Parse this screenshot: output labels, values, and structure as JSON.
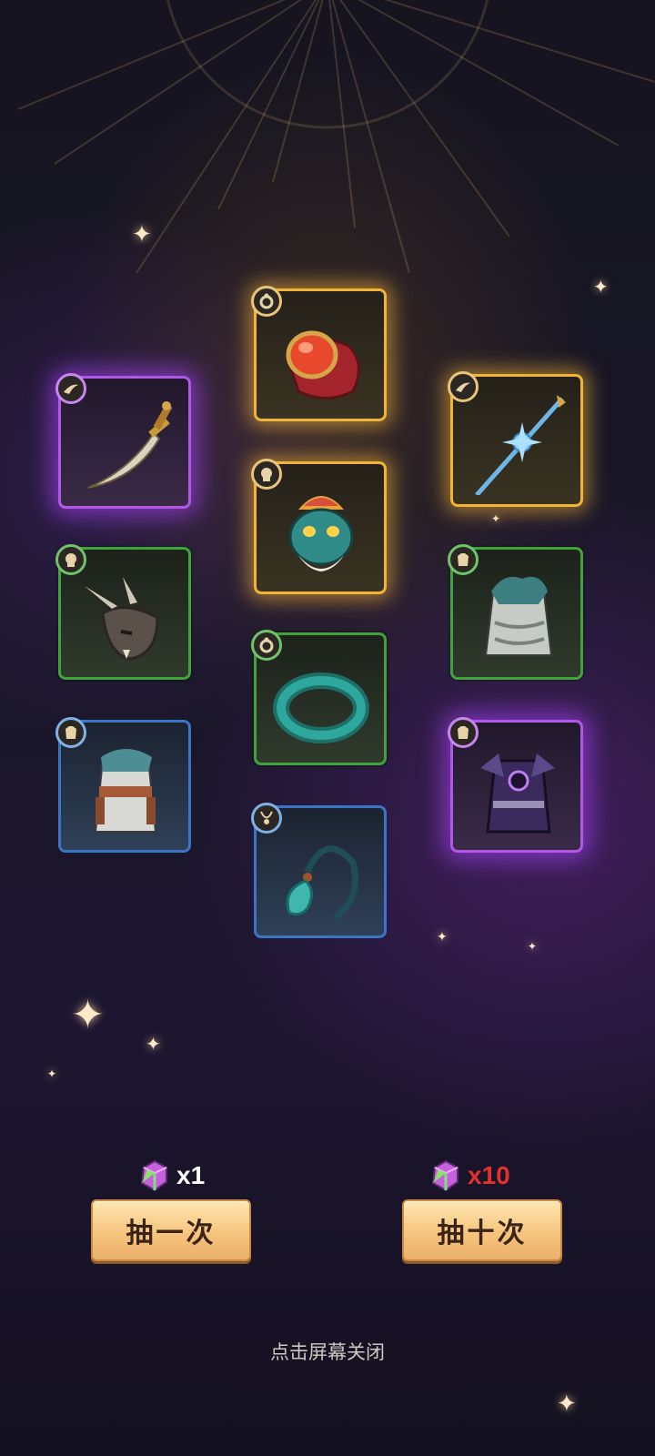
{
  "items": [
    {
      "name": "dagger",
      "rarity": "purple",
      "slot": "weapon"
    },
    {
      "name": "red-gem-ring",
      "rarity": "gold",
      "slot": "ring"
    },
    {
      "name": "ice-spear",
      "rarity": "gold",
      "slot": "weapon"
    },
    {
      "name": "monkey-king-mask",
      "rarity": "gold",
      "slot": "head"
    },
    {
      "name": "beast-mask",
      "rarity": "green",
      "slot": "head"
    },
    {
      "name": "jade-armor",
      "rarity": "green",
      "slot": "body"
    },
    {
      "name": "jade-ring",
      "rarity": "green",
      "slot": "ring"
    },
    {
      "name": "scout-robe",
      "rarity": "blue",
      "slot": "body"
    },
    {
      "name": "dark-armor",
      "rarity": "purple",
      "slot": "body"
    },
    {
      "name": "jade-pendant",
      "rarity": "blue",
      "slot": "necklace"
    }
  ],
  "draw_one": {
    "cost": "x1",
    "label": "抽一次"
  },
  "draw_ten": {
    "cost": "x10",
    "label": "抽十次"
  },
  "close_hint": "点击屏幕关闭",
  "colors": {
    "gold": "#f2b438",
    "purple": "#b158e6",
    "green": "#3fa43a",
    "blue": "#3b76c6",
    "cost_red": "#e4312b"
  }
}
